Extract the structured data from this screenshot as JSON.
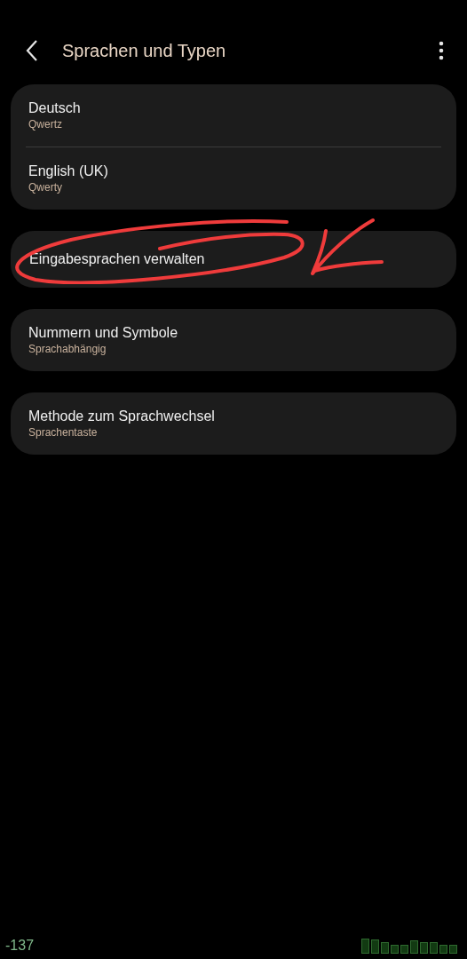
{
  "header": {
    "title": "Sprachen und Typen"
  },
  "groups": [
    {
      "items": [
        {
          "title": "Deutsch",
          "subtitle": "Qwertz"
        },
        {
          "title": "English (UK)",
          "subtitle": "Qwerty"
        }
      ]
    },
    {
      "items": [
        {
          "title": "Eingabesprachen verwalten"
        }
      ]
    },
    {
      "items": [
        {
          "title": "Nummern und Symbole",
          "subtitle": "Sprachabhängig"
        }
      ]
    },
    {
      "items": [
        {
          "title": "Methode zum Sprachwechsel",
          "subtitle": "Sprachentaste"
        }
      ]
    }
  ],
  "footer": {
    "reading": "-137"
  }
}
